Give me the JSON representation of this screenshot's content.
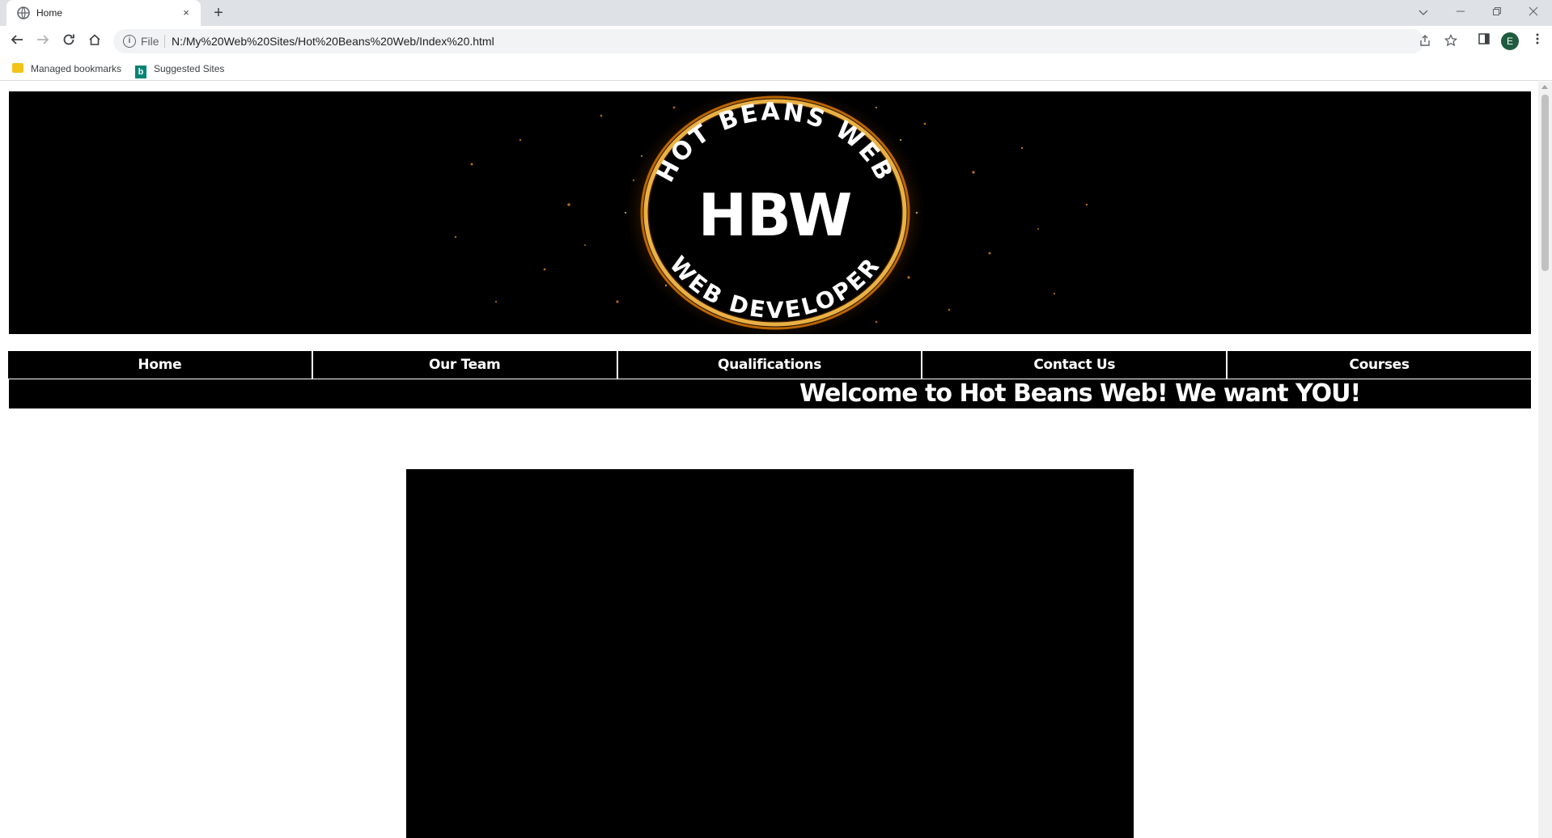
{
  "browser": {
    "tab_title": "Home",
    "tab_close": "×",
    "new_tab": "+",
    "omnibox_scheme": "File",
    "url": "N:/My%20Web%20Sites/Hot%20Beans%20Web/Index%20.html",
    "avatar_letter": "E",
    "icons": [
      "globe-icon",
      "back-icon",
      "forward-icon",
      "reload-icon",
      "home-icon",
      "info-icon",
      "share-icon",
      "star-icon",
      "side-panel-icon",
      "kebab-menu-icon",
      "minimize-icon",
      "restore-icon",
      "close-icon",
      "tab-search-icon"
    ]
  },
  "bookmarks": {
    "items": [
      {
        "label": "Managed bookmarks",
        "icon": "folder-icon"
      },
      {
        "label": "Suggested Sites",
        "icon": "bing-icon"
      }
    ]
  },
  "page": {
    "banner": {
      "logo_top_text": "HOT BEANS WEB",
      "logo_center_text": "HBW",
      "logo_bottom_text": "WEB DEVELOPER",
      "colors": {
        "background": "#000000",
        "ring": "#f5a623",
        "text": "#ffffff"
      }
    },
    "nav": [
      "Home",
      "Our Team",
      "Qualifications",
      "Contact Us",
      "Courses"
    ],
    "welcome": "Welcome to Hot Beans Web! We want YOU!"
  }
}
